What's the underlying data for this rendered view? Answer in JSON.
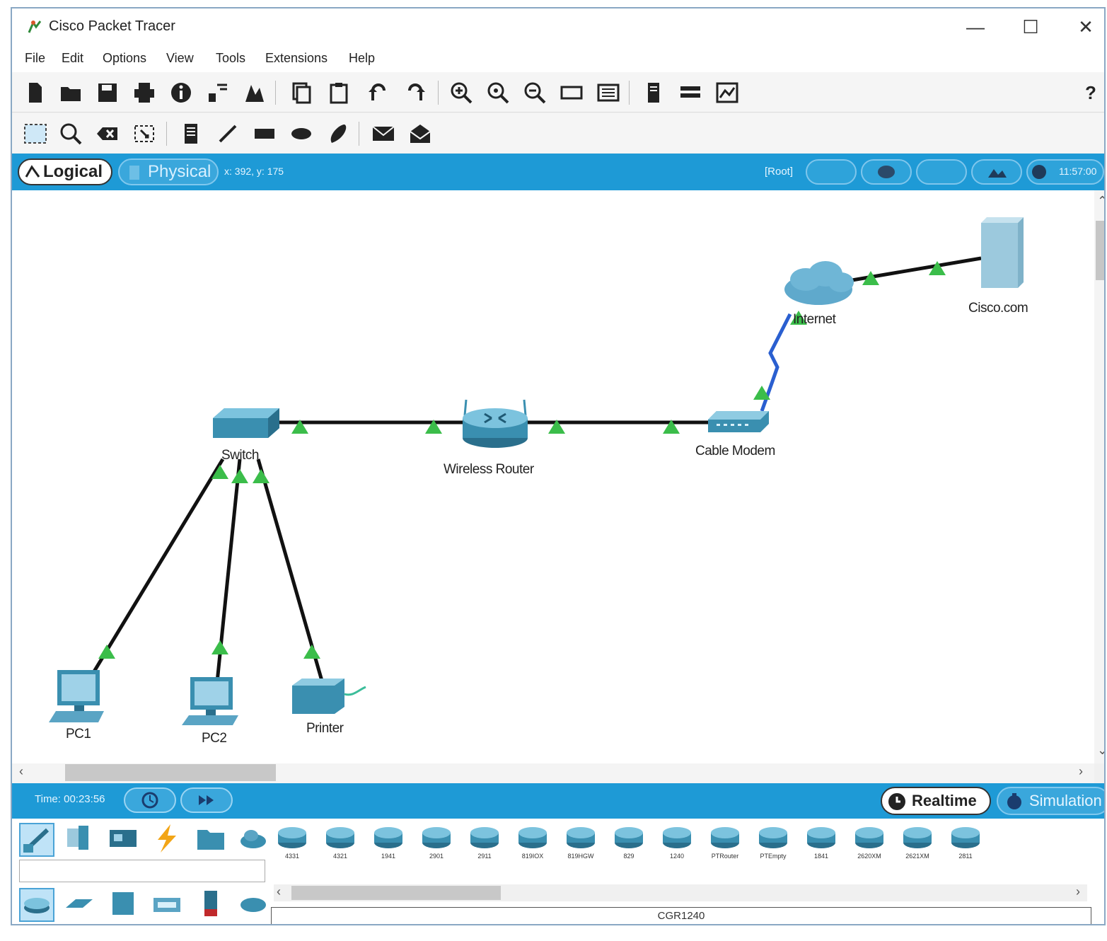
{
  "window": {
    "title": "Cisco Packet Tracer",
    "controls": {
      "minimize": "—",
      "maximize": "☐",
      "close": "✕"
    }
  },
  "menu": [
    "File",
    "Edit",
    "Options",
    "View",
    "Tools",
    "Extensions",
    "Help"
  ],
  "toolbar1": {
    "icons": [
      "new-icon",
      "open-icon",
      "save-icon",
      "print-icon",
      "info-icon",
      "network-info-icon",
      "activity-wizard-icon",
      "copy-icon",
      "paste-icon",
      "undo-icon",
      "redo-icon",
      "zoom-in-icon",
      "zoom-reset-icon",
      "zoom-out-icon",
      "drawing-rect-icon",
      "palette-icon",
      "custom-device-icon",
      "cluster-icon",
      "viewport-icon"
    ],
    "help": "?"
  },
  "toolbar2": {
    "icons": [
      "select-icon",
      "inspect-icon",
      "delete-icon",
      "resize-icon",
      "note-icon",
      "line-icon",
      "rectangle-icon",
      "ellipse-icon",
      "freeform-icon",
      "simple-pdu-icon",
      "complex-pdu-icon"
    ]
  },
  "viewbar": {
    "logical_label": "Logical",
    "physical_label": "Physical",
    "coords": "x: 392, y: 175",
    "root_label": "[Root]",
    "clock": "11:57:00"
  },
  "devices": {
    "switch": "Switch",
    "wireless_router": "Wireless Router",
    "cable_modem": "Cable Modem",
    "internet": "Internet",
    "server": "Cisco.com",
    "pc1": "PC1",
    "pc2": "PC2",
    "printer": "Printer"
  },
  "timebar": {
    "time": "Time: 00:23:56",
    "realtime_label": "Realtime",
    "simulation_label": "Simulation"
  },
  "device_models": [
    "4331",
    "4321",
    "1941",
    "2901",
    "2911",
    "819IOX",
    "819HGW",
    "829",
    "1240",
    "PTRouter",
    "PTEmpty",
    "1841",
    "2620XM",
    "2621XM",
    "2811"
  ],
  "selected_model": "CGR1240",
  "colors": {
    "accent_blue": "#1e9ad6",
    "device_teal": "#3a8fb0",
    "link_black": "#111111",
    "link_green": "#3bbd4a",
    "serial_blue": "#2a5fd0"
  }
}
